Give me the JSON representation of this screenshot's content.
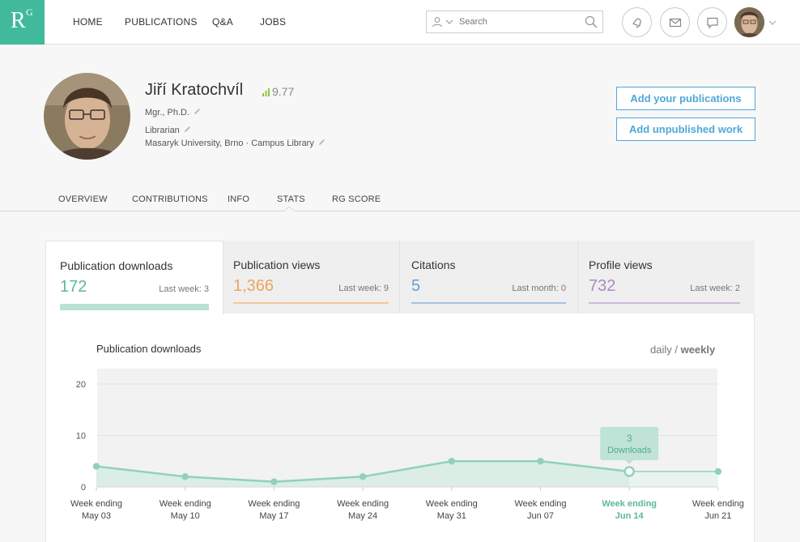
{
  "nav": {
    "logo_r": "R",
    "logo_g": "G",
    "items": [
      "HOME",
      "PUBLICATIONS",
      "Q&A",
      "JOBS"
    ],
    "search_placeholder": "Search"
  },
  "profile": {
    "name": "Jiří Kratochvíl",
    "score": "9.77",
    "degree": "Mgr., Ph.D.",
    "position": "Librarian",
    "institution": "Masaryk University, Brno · Campus Library",
    "add_publications": "Add your publications",
    "add_unpublished": "Add unpublished work"
  },
  "tabs": [
    "OVERVIEW",
    "CONTRIBUTIONS",
    "INFO",
    "STATS",
    "RG SCORE"
  ],
  "active_tab": "STATS",
  "stats": [
    {
      "label": "Publication downloads",
      "value": "172",
      "sub": "Last week: 3",
      "color": "#5cb899",
      "bar": "#b8e3d3"
    },
    {
      "label": "Publication views",
      "value": "1,366",
      "sub": "Last week: 9",
      "color": "#eea45d",
      "bar": "#f3c89c"
    },
    {
      "label": "Citations",
      "value": "5",
      "sub": "Last month: 0",
      "color": "#6a9fce",
      "bar": "#a6c4e0"
    },
    {
      "label": "Profile views",
      "value": "732",
      "sub": "Last week: 2",
      "color": "#a98ac2",
      "bar": "#cdb8dc"
    }
  ],
  "chart_toggle": {
    "daily": "daily",
    "sep": " / ",
    "weekly": "weekly"
  },
  "tooltip": {
    "value": "3",
    "label": "Downloads"
  },
  "chart_data": {
    "type": "area",
    "title": "Publication downloads",
    "xlabel": "",
    "ylabel": "",
    "ylim": [
      0,
      23
    ],
    "yticks": [
      0,
      10,
      20
    ],
    "grid": true,
    "categories": [
      [
        "Week ending",
        "May 03"
      ],
      [
        "Week ending",
        "May 10"
      ],
      [
        "Week ending",
        "May 17"
      ],
      [
        "Week ending",
        "May 24"
      ],
      [
        "Week ending",
        "May 31"
      ],
      [
        "Week ending",
        "Jun 07"
      ],
      [
        "Week ending",
        "Jun 14"
      ],
      [
        "Week ending",
        "Jun 21"
      ]
    ],
    "values": [
      4,
      2,
      1,
      2,
      5,
      5,
      3,
      3
    ],
    "highlight_index": 6,
    "colors": {
      "line": "#91d1bb",
      "fill": "#dbeee6",
      "bg": "#f2f2f2",
      "highlight": "#5cb899"
    }
  }
}
